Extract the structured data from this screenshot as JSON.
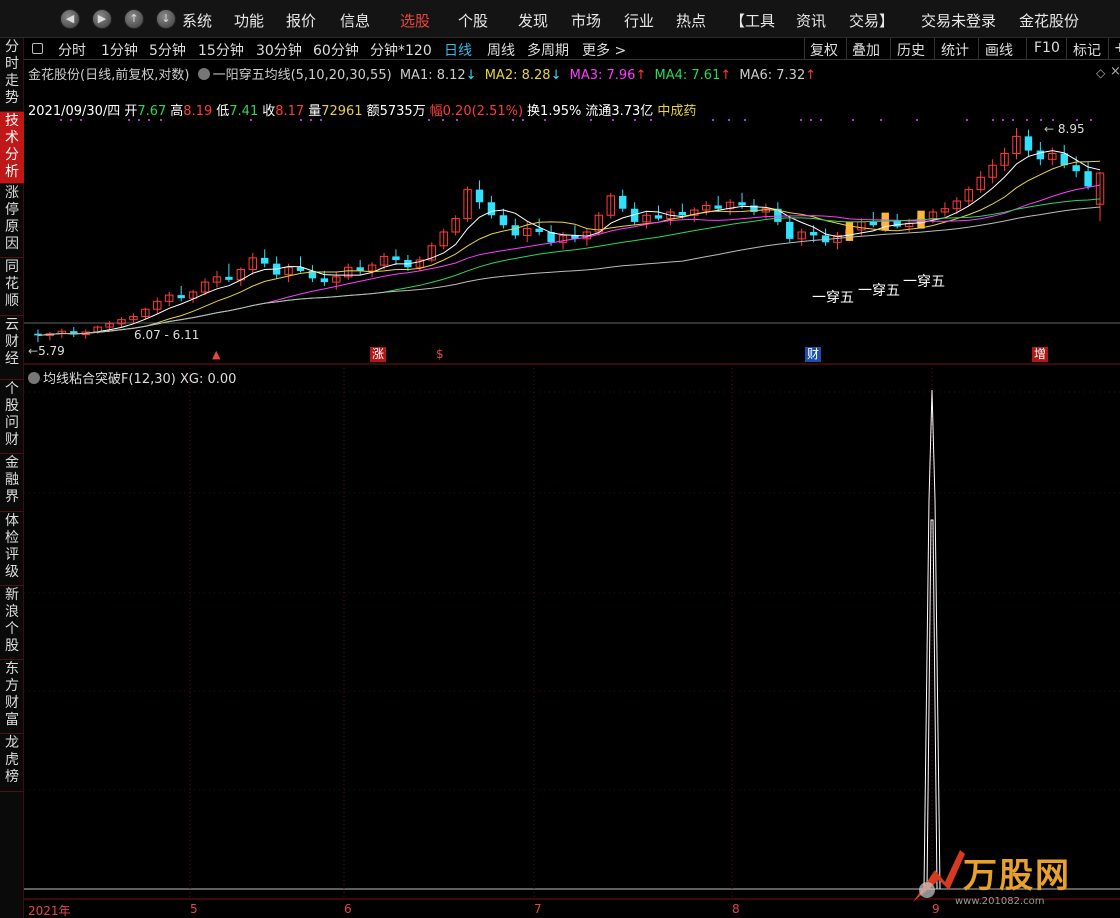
{
  "topbar": {
    "nav_buttons": [
      "◀",
      "▶",
      "↑",
      "↓"
    ],
    "menu": [
      "系统",
      "功能",
      "报价",
      "信息",
      "选股",
      "个股",
      "发现",
      "市场",
      "行业",
      "热点",
      "【工具",
      "资讯",
      "交易】",
      "交易未登录",
      "金花股份"
    ],
    "active_menu": "选股"
  },
  "left_tabs": [
    "分时走势",
    "技术分析",
    "涨停原因",
    "同花顺",
    "云财经",
    "个股问财",
    "金融界",
    "体检评级",
    "新浪个股",
    "东方财富",
    "龙虎榜"
  ],
  "active_left_tab": "技术分析",
  "toolbar": {
    "periods": [
      "分时",
      "1分钟",
      "5分钟",
      "15分钟",
      "30分钟",
      "60分钟",
      "分钟*120",
      "日线",
      "周线",
      "多周期",
      "更多 >"
    ],
    "active_period": "日线",
    "right_buttons": [
      "复权",
      "叠加",
      "历史",
      "统计",
      "画线",
      "F10",
      "标记",
      "+"
    ]
  },
  "chart_header": {
    "stock": "金花股份(日线,前复权,对数)",
    "indicator": "一阳穿五均线(5,10,20,30,55)",
    "ma": [
      {
        "label": "MA1: 8.12",
        "arrow": "↓",
        "color": "#cccccc"
      },
      {
        "label": "MA2: 8.28",
        "arrow": "↓",
        "color": "#e8d23a"
      },
      {
        "label": "MA3: 7.96",
        "arrow": "↑",
        "color": "#ff3cff"
      },
      {
        "label": "MA4: 7.61",
        "arrow": "↑",
        "color": "#26d95a"
      },
      {
        "label": "MA6: 7.32",
        "arrow": "↑",
        "color": "#cccccc"
      }
    ]
  },
  "quote_line": {
    "date": "2021/09/30/四",
    "open_label": "开",
    "open": "7.67",
    "high_label": "高",
    "high": "8.19",
    "low_label": "低",
    "low": "7.41",
    "close_label": "收",
    "close": "8.17",
    "vol_label": "量",
    "vol": "72961",
    "amount": "额5735万",
    "change": "幅0.20(2.51%)",
    "turnover": "换1.95%",
    "float": "流通3.73亿",
    "concept": "中成药"
  },
  "chart_annotations": {
    "max_label": "8.95",
    "min_label": "5.79",
    "range_label": "6.07 - 6.11",
    "signal_label": "一穿五",
    "event_markers": [
      "涨",
      "$",
      "财",
      "增"
    ]
  },
  "lower_panel": {
    "title": "均线粘合突破F(12,30)",
    "xg": "XG: 0.00"
  },
  "x_axis": [
    "2021年",
    "5",
    "6",
    "7",
    "8",
    "9"
  ],
  "watermark": {
    "text": "万股网",
    "url": "www.201082.com"
  },
  "colors": {
    "up": "#ff3b3b",
    "down": "#2fe0ff",
    "ma1": "#ffffff",
    "ma2": "#e8d23a",
    "ma3": "#ff3cff",
    "ma4": "#26d95a",
    "ma6": "#bbbbbb",
    "signal": "#ffb43a"
  },
  "chart_data": {
    "type": "candlestick",
    "price_range": [
      5.79,
      8.95
    ],
    "candles": [
      [
        5.9,
        5.95,
        5.8,
        5.88
      ],
      [
        5.88,
        5.92,
        5.82,
        5.9
      ],
      [
        5.9,
        5.96,
        5.85,
        5.93
      ],
      [
        5.93,
        5.98,
        5.86,
        5.89
      ],
      [
        5.89,
        5.95,
        5.84,
        5.92
      ],
      [
        5.92,
        6.0,
        5.9,
        5.98
      ],
      [
        5.98,
        6.05,
        5.93,
        6.02
      ],
      [
        6.02,
        6.1,
        5.98,
        6.07
      ],
      [
        6.07,
        6.15,
        6.03,
        6.11
      ],
      [
        6.11,
        6.22,
        6.08,
        6.2
      ],
      [
        6.2,
        6.35,
        6.15,
        6.3
      ],
      [
        6.3,
        6.42,
        6.24,
        6.38
      ],
      [
        6.38,
        6.5,
        6.3,
        6.34
      ],
      [
        6.34,
        6.45,
        6.28,
        6.42
      ],
      [
        6.42,
        6.6,
        6.38,
        6.55
      ],
      [
        6.55,
        6.7,
        6.48,
        6.62
      ],
      [
        6.62,
        6.8,
        6.55,
        6.58
      ],
      [
        6.58,
        6.75,
        6.5,
        6.72
      ],
      [
        6.72,
        6.95,
        6.65,
        6.88
      ],
      [
        6.88,
        7.0,
        6.75,
        6.8
      ],
      [
        6.8,
        6.9,
        6.6,
        6.65
      ],
      [
        6.65,
        6.8,
        6.55,
        6.75
      ],
      [
        6.75,
        6.9,
        6.68,
        6.7
      ],
      [
        6.7,
        6.78,
        6.55,
        6.6
      ],
      [
        6.6,
        6.7,
        6.5,
        6.55
      ],
      [
        6.55,
        6.68,
        6.45,
        6.62
      ],
      [
        6.62,
        6.8,
        6.58,
        6.75
      ],
      [
        6.75,
        6.85,
        6.65,
        6.7
      ],
      [
        6.7,
        6.82,
        6.62,
        6.78
      ],
      [
        6.78,
        6.95,
        6.72,
        6.9
      ],
      [
        6.9,
        7.0,
        6.78,
        6.85
      ],
      [
        6.85,
        6.92,
        6.7,
        6.75
      ],
      [
        6.75,
        6.9,
        6.7,
        6.85
      ],
      [
        6.85,
        7.1,
        6.82,
        7.05
      ],
      [
        7.05,
        7.3,
        7.0,
        7.25
      ],
      [
        7.25,
        7.5,
        7.2,
        7.45
      ],
      [
        7.45,
        7.95,
        7.4,
        7.9
      ],
      [
        7.9,
        8.05,
        7.6,
        7.7
      ],
      [
        7.7,
        7.8,
        7.45,
        7.5
      ],
      [
        7.5,
        7.6,
        7.3,
        7.35
      ],
      [
        7.35,
        7.45,
        7.15,
        7.2
      ],
      [
        7.2,
        7.4,
        7.1,
        7.3
      ],
      [
        7.3,
        7.45,
        7.2,
        7.25
      ],
      [
        7.25,
        7.35,
        7.05,
        7.1
      ],
      [
        7.1,
        7.25,
        7.0,
        7.2
      ],
      [
        7.2,
        7.35,
        7.1,
        7.15
      ],
      [
        7.15,
        7.3,
        7.05,
        7.25
      ],
      [
        7.25,
        7.55,
        7.2,
        7.5
      ],
      [
        7.5,
        7.85,
        7.45,
        7.8
      ],
      [
        7.8,
        7.9,
        7.55,
        7.6
      ],
      [
        7.6,
        7.7,
        7.35,
        7.4
      ],
      [
        7.4,
        7.55,
        7.3,
        7.5
      ],
      [
        7.5,
        7.65,
        7.42,
        7.45
      ],
      [
        7.45,
        7.6,
        7.35,
        7.55
      ],
      [
        7.55,
        7.68,
        7.45,
        7.5
      ],
      [
        7.5,
        7.62,
        7.4,
        7.58
      ],
      [
        7.58,
        7.72,
        7.5,
        7.65
      ],
      [
        7.65,
        7.8,
        7.55,
        7.6
      ],
      [
        7.6,
        7.75,
        7.5,
        7.7
      ],
      [
        7.7,
        7.85,
        7.6,
        7.65
      ],
      [
        7.65,
        7.75,
        7.5,
        7.55
      ],
      [
        7.55,
        7.68,
        7.45,
        7.6
      ],
      [
        7.6,
        7.7,
        7.35,
        7.4
      ],
      [
        7.4,
        7.5,
        7.1,
        7.15
      ],
      [
        7.15,
        7.3,
        7.05,
        7.25
      ],
      [
        7.25,
        7.35,
        7.1,
        7.2
      ],
      [
        7.2,
        7.3,
        7.05,
        7.1
      ],
      [
        7.1,
        7.25,
        7.0,
        7.2
      ],
      [
        7.2,
        7.35,
        7.12,
        7.28
      ],
      [
        7.28,
        7.45,
        7.2,
        7.4
      ],
      [
        7.4,
        7.55,
        7.32,
        7.35
      ],
      [
        7.35,
        7.48,
        7.25,
        7.42
      ],
      [
        7.42,
        7.52,
        7.3,
        7.33
      ],
      [
        7.33,
        7.45,
        7.25,
        7.38
      ],
      [
        7.38,
        7.5,
        7.3,
        7.45
      ],
      [
        7.45,
        7.6,
        7.38,
        7.55
      ],
      [
        7.55,
        7.7,
        7.48,
        7.6
      ],
      [
        7.6,
        7.78,
        7.52,
        7.72
      ],
      [
        7.72,
        7.95,
        7.65,
        7.9
      ],
      [
        7.9,
        8.2,
        7.85,
        8.1
      ],
      [
        8.1,
        8.4,
        8.0,
        8.3
      ],
      [
        8.3,
        8.6,
        8.2,
        8.5
      ],
      [
        8.5,
        8.95,
        8.4,
        8.8
      ],
      [
        8.8,
        8.92,
        8.45,
        8.55
      ],
      [
        8.55,
        8.7,
        8.3,
        8.4
      ],
      [
        8.4,
        8.6,
        8.3,
        8.5
      ],
      [
        8.5,
        8.65,
        8.25,
        8.3
      ],
      [
        8.3,
        8.45,
        8.1,
        8.2
      ],
      [
        8.2,
        8.35,
        7.9,
        7.95
      ],
      [
        7.67,
        8.19,
        7.41,
        8.17
      ]
    ]
  }
}
